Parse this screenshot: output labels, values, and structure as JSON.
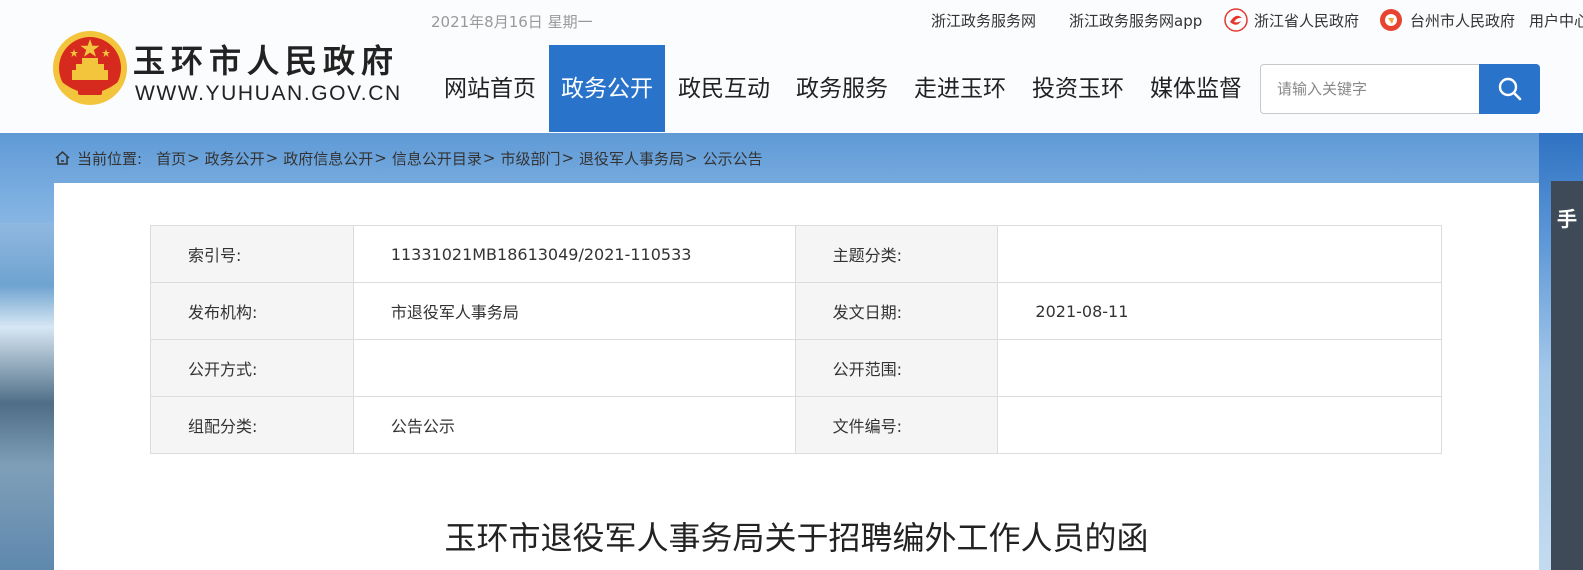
{
  "header": {
    "site_name": "玉环市人民政府",
    "site_url": "WWW.YUHUAN.GOV.CN",
    "date": "2021年8月16日 星期一"
  },
  "top_links": [
    {
      "label": "浙江政务服务网",
      "icon": null
    },
    {
      "label": "浙江政务服务网app",
      "icon": null
    },
    {
      "label": "浙江省人民政府",
      "icon": "zhejiang-gov-logo-icon"
    },
    {
      "label": "台州市人民政府",
      "icon": "taizhou-gov-logo-icon"
    },
    {
      "label": "用户中心",
      "icon": null
    }
  ],
  "nav": {
    "items": [
      {
        "label": "网站首页",
        "active": false
      },
      {
        "label": "政务公开",
        "active": true
      },
      {
        "label": "政民互动",
        "active": false
      },
      {
        "label": "政务服务",
        "active": false
      },
      {
        "label": "走进玉环",
        "active": false
      },
      {
        "label": "投资玉环",
        "active": false
      },
      {
        "label": "媒体监督",
        "active": false
      }
    ],
    "active_color": "#2a73cb"
  },
  "search": {
    "placeholder": "请输入关键字",
    "button_icon": "search-icon"
  },
  "breadcrumb": {
    "label": "当前位置:",
    "items": [
      "首页",
      "政务公开",
      "政府信息公开",
      "信息公开目录",
      "市级部门",
      "退役军人事务局",
      "公示公告"
    ],
    "separator": ">"
  },
  "side_tab": {
    "label": "手"
  },
  "meta": {
    "rows": [
      {
        "l1": "索引号:",
        "v1": "11331021MB18613049/2021-110533",
        "l2": "主题分类:",
        "v2": ""
      },
      {
        "l1": "发布机构:",
        "v1": "市退役军人事务局",
        "l2": "发文日期:",
        "v2": "2021-08-11"
      },
      {
        "l1": "公开方式:",
        "v1": "",
        "l2": "公开范围:",
        "v2": ""
      },
      {
        "l1": "组配分类:",
        "v1": "公告公示",
        "l2": "文件编号:",
        "v2": ""
      }
    ]
  },
  "article": {
    "title": "玉环市退役军人事务局关于招聘编外工作人员的函"
  },
  "colors": {
    "brand_blue": "#2a73cb",
    "emblem_red": "#d62a1e",
    "emblem_gold": "#f3c53c"
  }
}
